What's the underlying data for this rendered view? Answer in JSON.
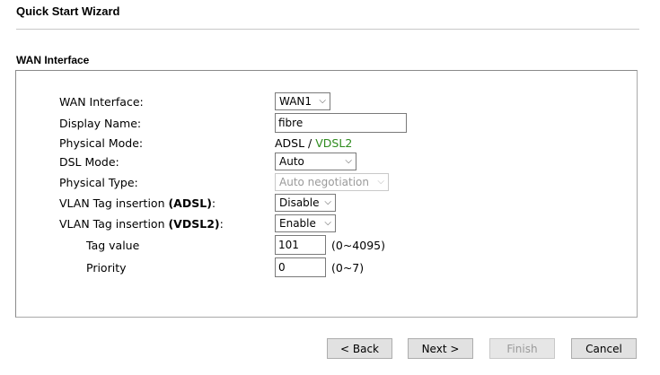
{
  "page": {
    "title": "Quick Start Wizard",
    "section_title": "WAN Interface"
  },
  "form": {
    "wan_interface": {
      "label": "WAN Interface:",
      "value": "WAN1"
    },
    "display_name": {
      "label": "Display Name:",
      "value": "fibre"
    },
    "physical_mode": {
      "label": "Physical Mode:",
      "value_adsl": "ADSL",
      "separator": " / ",
      "value_vdsl2": "VDSL2"
    },
    "dsl_mode": {
      "label": "DSL Mode:",
      "value": "Auto"
    },
    "physical_type": {
      "label": "Physical Type:",
      "value": "Auto negotiation"
    },
    "vlan_adsl": {
      "label_prefix": "VLAN Tag insertion ",
      "label_bold": "(ADSL)",
      "label_suffix": ":",
      "value": "Disable"
    },
    "vlan_vdsl2": {
      "label_prefix": "VLAN Tag insertion ",
      "label_bold": "(VDSL2)",
      "label_suffix": ":",
      "value": "Enable"
    },
    "tag_value": {
      "label": "Tag value",
      "value": "101",
      "hint": "(0~4095)"
    },
    "priority": {
      "label": "Priority",
      "value": "0",
      "hint": "(0~7)"
    }
  },
  "buttons": {
    "back": "< Back",
    "next": "Next >",
    "finish": "Finish",
    "cancel": "Cancel"
  },
  "colors": {
    "vdsl2_accent": "#2e8b1e"
  }
}
